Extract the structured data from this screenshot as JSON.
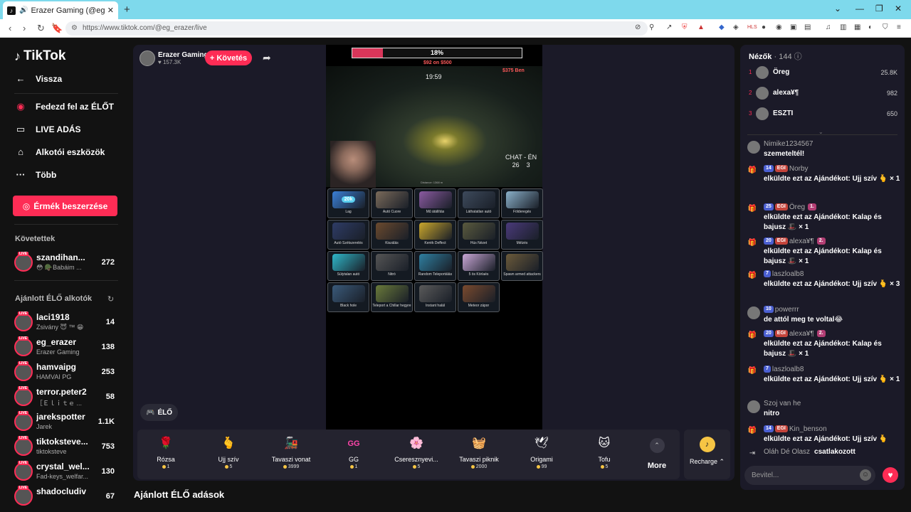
{
  "browser": {
    "tab_title": "Erazer Gaming (@eg_erazer) ‏",
    "url": "https://www.tiktok.com/@eg_erazer/live"
  },
  "sidebar": {
    "logo": "TikTok",
    "back": "Vissza",
    "nav": [
      {
        "label": "Fedezd fel az ÉLŐT",
        "icon": "explore-live-icon"
      },
      {
        "label": "LIVE ADÁS",
        "icon": "camera-icon"
      },
      {
        "label": "Alkotói eszközök",
        "icon": "creator-tools-icon"
      },
      {
        "label": "Több",
        "icon": "more-dots-icon"
      }
    ],
    "coins_button": "Érmék beszerzése",
    "following_header": "Követettek",
    "following": [
      {
        "name": "szandihan...",
        "sub": "😳 🪖Babáim ...",
        "count": "272"
      }
    ],
    "recommended_header": "Ajánlott ÉLŐ alkotók",
    "recommended": [
      {
        "name": "laci1918",
        "sub": "Zsivány 😇 ™ 😁",
        "count": "14"
      },
      {
        "name": "eg_erazer",
        "sub": "Erazer Gaming",
        "count": "138"
      },
      {
        "name": "hamvaipg",
        "sub": "HAMVAI PG",
        "count": "253"
      },
      {
        "name": "terror.peter2",
        "sub": "［Ｅｌｉｔｅ ...",
        "count": "58"
      },
      {
        "name": "jarekspotter",
        "sub": "Jarek",
        "count": "1.1K"
      },
      {
        "name": "tiktoksteve...",
        "sub": "tiktoksteve",
        "count": "753"
      },
      {
        "name": "crystal_wel...",
        "sub": "Fad-keys_welfar...",
        "count": "130"
      },
      {
        "name": "shadocludiv",
        "sub": "",
        "count": "67"
      }
    ]
  },
  "host": {
    "name": "Erazer Gaming",
    "likes": "157.3K",
    "follow_label": "+ Követés"
  },
  "stream": {
    "progress_label": "18%",
    "progress": 0.18,
    "goal_text": "$92 on $500",
    "top_right": "$375 Ben",
    "timer": "19:59",
    "chat_label": "CHAT - ÉN",
    "chat_score_left": "26",
    "chat_score_right": "3",
    "distance": "Distance: 1368 m",
    "live_label": "ÉLŐ",
    "cards": [
      {
        "label": "Lag",
        "bubble": "20k",
        "color": "#3a7fd6"
      },
      {
        "label": "Autó Cuore",
        "color": "#7a6a5a"
      },
      {
        "label": "Mű átállítás",
        "color": "#8a5aa0"
      },
      {
        "label": "Láthatatlan autó",
        "color": "#3d4a5c"
      },
      {
        "label": "Földeregés",
        "color": "#8ab0c9"
      },
      {
        "label": "Autó Szétszerelés",
        "color": "#2e3c66"
      },
      {
        "label": "Kiszálás",
        "color": "#6b4a2e"
      },
      {
        "label": "Kerék Deffect",
        "color": "#c9a62c"
      },
      {
        "label": "Hús Nézet",
        "color": "#5a5a3e"
      },
      {
        "label": "Mélzés",
        "color": "#4a3a7a"
      },
      {
        "label": "Súlytalan autó",
        "color": "#2fb7c9"
      },
      {
        "label": "Nitró",
        "color": "#555555"
      },
      {
        "label": "Random Teleportálás",
        "color": "#2f7fa0"
      },
      {
        "label": "5 ös Körlaés",
        "color": "#c9a7d6"
      },
      {
        "label": "Spawn armed attackers",
        "color": "#6b5a3a"
      },
      {
        "label": "Black hole",
        "color": "#3a5a7a"
      },
      {
        "label": "Teleport a Chillar hegyre",
        "color": "#6a7a3a"
      },
      {
        "label": "Instant halál",
        "color": "#5a5a5a"
      },
      {
        "label": "Meteor zápor",
        "color": "#7a4a2e"
      }
    ]
  },
  "gifts": [
    {
      "name": "Rózsa",
      "price": "1",
      "icon": "🌹"
    },
    {
      "name": "Ujj szív",
      "price": "5",
      "icon": "🫰"
    },
    {
      "name": "Tavaszi vonat",
      "price": "3999",
      "icon": "🚂"
    },
    {
      "name": "GG",
      "price": "1",
      "icon": "GG"
    },
    {
      "name": "Cseresznyevi...",
      "price": "5",
      "icon": "🌸"
    },
    {
      "name": "Tavaszi piknik",
      "price": "2000",
      "icon": "🧺"
    },
    {
      "name": "Origami",
      "price": "99",
      "icon": "🕊"
    },
    {
      "name": "Tofu",
      "price": "5",
      "icon": "🐱"
    }
  ],
  "gift_more": "More",
  "recharge": "Recharge",
  "recommended_below": "Ajánlott ÉLŐ adások",
  "chat": {
    "viewers_label": "Nézők",
    "viewers_count": "144",
    "top": [
      {
        "rank": "1",
        "name": "Öreg",
        "score": "25.8K"
      },
      {
        "rank": "2",
        "name": "alexa¥¶",
        "score": "982"
      },
      {
        "rank": "3",
        "name": "ESZTI",
        "score": "650"
      }
    ],
    "messages": [
      {
        "head": "Nimike1234567",
        "body": "szemeteltél!"
      },
      {
        "head": "Norby",
        "lvl": "14",
        "fan": "EGI",
        "body": "elküldte ezt az Ajándékot: Ujj szív 🫰 × 1"
      },
      {
        "head": "Öreg",
        "lvl": "25",
        "fan": "EGI",
        "sub": "1.",
        "body": "elküldte ezt az Ajándékot: Kalap és bajusz 🎩 × 1"
      },
      {
        "head": "alexa¥¶",
        "lvl": "20",
        "fan": "EGI",
        "sub": "2.",
        "body": "elküldte ezt az Ajándékot: Kalap és bajusz 🎩 × 1"
      },
      {
        "head": "laszloalb8",
        "lvl": "7",
        "body": "elküldte ezt az Ajándékot: Ujj szív 🫰 × 3"
      },
      {
        "head": "powerrr",
        "lvl": "10",
        "body": "de attól meg te voltal😂"
      },
      {
        "head": "alexa¥¶",
        "lvl": "20",
        "fan": "EGI",
        "sub": "2.",
        "body": "elküldte ezt az Ajándékot: Kalap és bajusz 🎩 × 1"
      },
      {
        "head": "laszloalb8",
        "lvl": "7",
        "body": "elküldte ezt az Ajándékot: Ujj szív 🫰 × 1"
      },
      {
        "head": "Szoj van he",
        "body": "nitro"
      },
      {
        "head": "Kin_benson",
        "lvl": "14",
        "fan": "EGI",
        "body": "elküldte ezt az Ajándékot: Ujj szív 🫰"
      },
      {
        "head": "Oláh Dé Olasz",
        "body": "csatlakozott"
      }
    ],
    "input_placeholder": "Bevitel..."
  }
}
